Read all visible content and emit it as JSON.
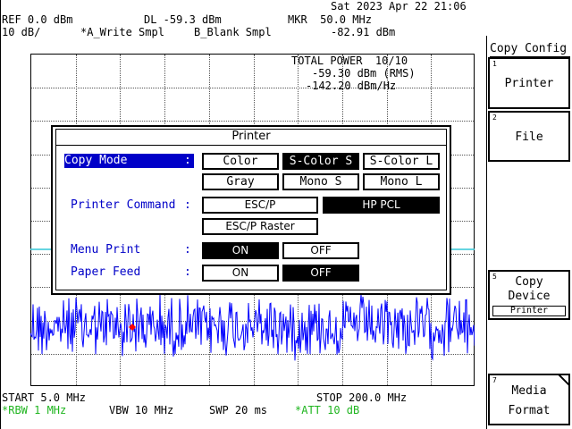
{
  "datetime": "Sat 2023 Apr 22 21:06",
  "header": {
    "ref": "REF 0.0 dBm",
    "dl": "DL -59.3 dBm",
    "mkr": "MKR  50.0 MHz",
    "scale": "10 dB/",
    "trace_a": "*A_Write Smpl",
    "trace_b": "B_Blank Smpl",
    "mkr_value": "-82.91 dBm"
  },
  "measurement": {
    "title": "TOTAL POWER  10/10",
    "rms": "-59.30 dBm (RMS)",
    "density": "-142.20 dBm/Hz"
  },
  "footer": {
    "start": "START 5.0 MHz",
    "stop": "STOP 200.0 MHz",
    "rbw": "*RBW 1 MHz",
    "vbw": "VBW 10 MHz",
    "swp": "SWP 20 ms",
    "att": "*ATT 10 dB"
  },
  "softkeys": {
    "menu_title": "Copy Config",
    "keys": [
      {
        "num": "1",
        "label": "Printer"
      },
      {
        "num": "2",
        "label": "File"
      },
      {
        "num": "5",
        "label1": "Copy",
        "label2": "Device",
        "sub": "Printer"
      },
      {
        "num": "7",
        "label1": "Media",
        "label2": "Format"
      }
    ]
  },
  "dialog": {
    "title": "Printer",
    "copy_mode": {
      "label": "Copy Mode",
      "colon": ":",
      "options": [
        "Color",
        "S-Color S",
        "S-Color L",
        "Gray",
        "Mono S",
        "Mono L"
      ],
      "selected": "S-Color S"
    },
    "printer_command": {
      "label": "Printer Command",
      "colon": ":",
      "options": [
        "ESC/P",
        "HP PCL",
        "ESC/P Raster"
      ],
      "selected": "HP PCL"
    },
    "menu_print": {
      "label": "Menu Print",
      "colon": ":",
      "options": [
        "ON",
        "OFF"
      ],
      "selected": "ON"
    },
    "paper_feed": {
      "label": "Paper Feed",
      "colon": ":",
      "options": [
        "ON",
        "OFF"
      ],
      "selected": "OFF"
    }
  },
  "colors": {
    "trace": "#0000ff",
    "label_blue": "#0000c8",
    "display_line": "#33c7d7",
    "marker": "#ff0000",
    "status_green": "#1fb51f"
  }
}
